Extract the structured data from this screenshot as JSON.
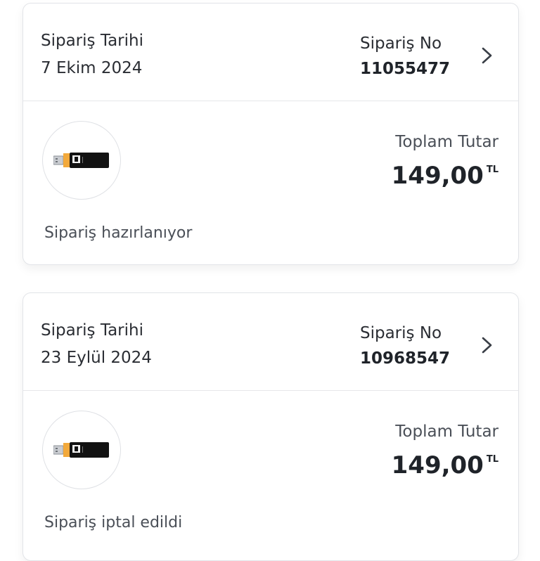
{
  "orders": [
    {
      "date_label": "Sipariş Tarihi",
      "date": "7 Ekim 2024",
      "order_no_label": "Sipariş No",
      "order_no": "11055477",
      "total_label": "Toplam Tutar",
      "total_amount": "149,00",
      "currency": "TL",
      "status": "Sipariş hazırlanıyor",
      "product_icon": "usb-flash-drive-icon"
    },
    {
      "date_label": "Sipariş Tarihi",
      "date": "23 Eylül 2024",
      "order_no_label": "Sipariş No",
      "order_no": "10968547",
      "total_label": "Toplam Tutar",
      "total_amount": "149,00",
      "currency": "TL",
      "status": "Sipariş iptal edildi",
      "product_icon": "usb-flash-drive-icon"
    }
  ],
  "colors": {
    "text_primary": "#1f2329",
    "text_secondary": "#4a4f57",
    "border": "#e2e4e8",
    "drive_accent": "#f2a93b"
  }
}
